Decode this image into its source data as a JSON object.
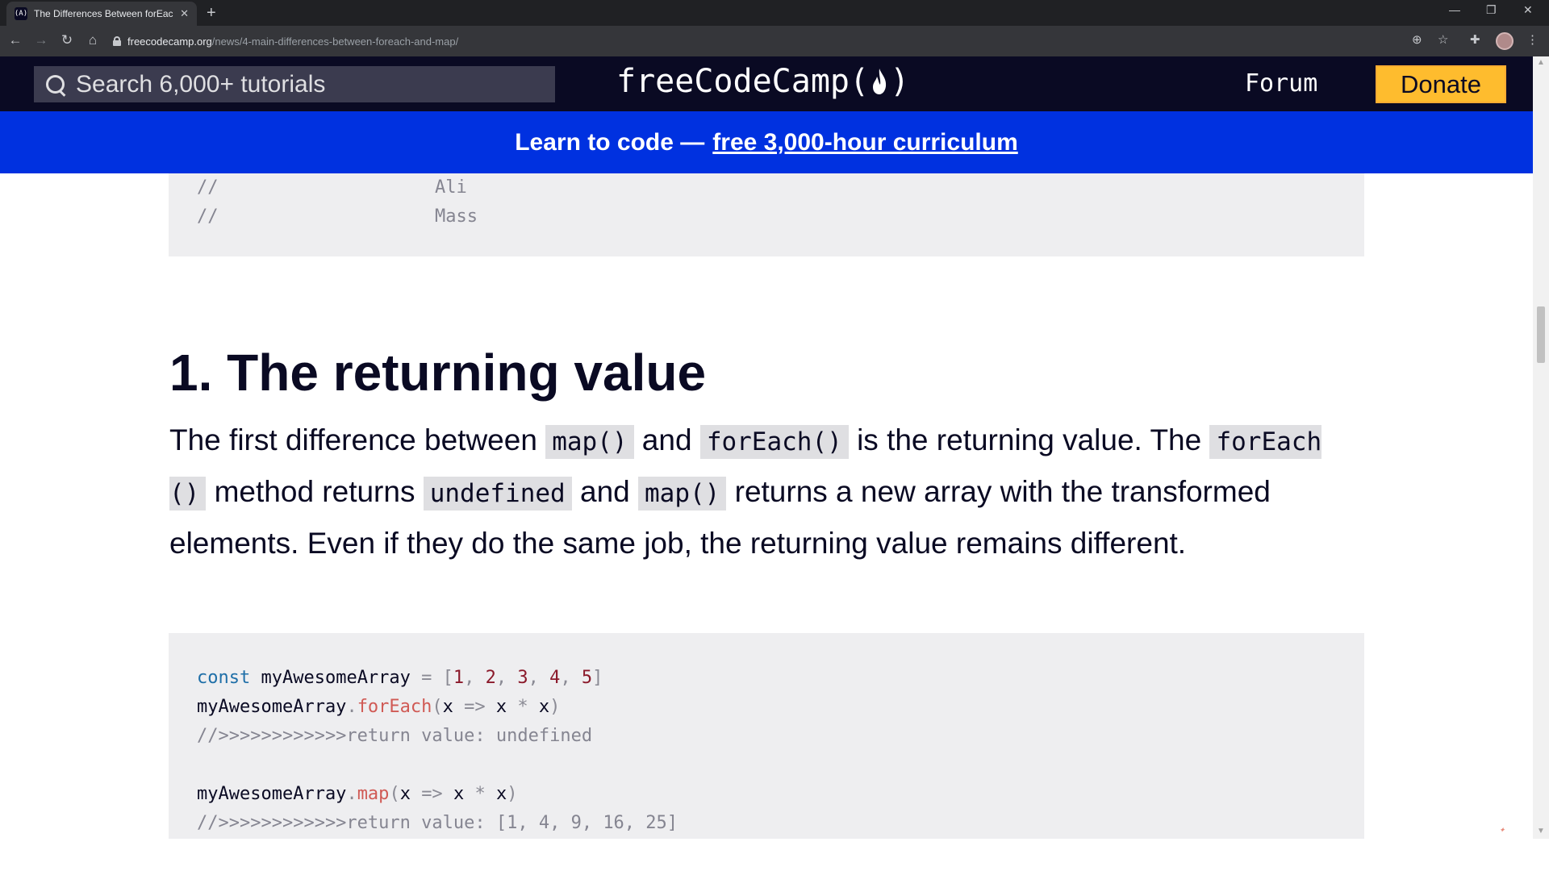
{
  "browser": {
    "tab_title": "The Differences Between forEach",
    "tab_favicon": "(A)",
    "new_tab_icon": "+",
    "url_host": "freecodecamp.org",
    "url_path": "/news/4-main-differences-between-foreach-and-map/",
    "icons": [
      "back-arrow-icon",
      "forward-arrow-icon",
      "reload-icon",
      "home-icon",
      "lock-icon",
      "zoom-icon",
      "star-icon",
      "extensions-icon",
      "profile-avatar",
      "kebab-menu-icon",
      "minimize-icon",
      "restore-icon",
      "close-icon"
    ]
  },
  "site": {
    "search_placeholder": "Search 6,000+ tutorials",
    "logo_text": "freeCodeCamp(",
    "logo_close": ")",
    "forum_label": "Forum",
    "donate_label": "Donate",
    "banner_text": "Learn to code —",
    "banner_link": "free 3,000-hour curriculum",
    "colors": {
      "nav_bg": "#0a0a23",
      "banner_bg": "#0031e0",
      "donate_bg": "#febc2e"
    }
  },
  "article": {
    "prev_code": [
      {
        "slashes": "//",
        "value": "Ali"
      },
      {
        "slashes": "//",
        "value": "Mass"
      }
    ],
    "heading": "1. The returning value",
    "paragraph": {
      "t1": "The first difference between ",
      "c1": "map()",
      "t2": " and ",
      "c2": "forEach()",
      "t3": " is the returning value. The ",
      "c3": "forEach ()",
      "t4": " method returns ",
      "c4": "undefined",
      "t5": " and ",
      "c5": "map()",
      "t6": " returns a new array with the transformed elements. Even if they do the same job, the returning value remains different."
    },
    "code": {
      "kw_const": "const",
      "array_name": "myAwesomeArray",
      "eq": "=",
      "open": "[",
      "close": "]",
      "comma": ",",
      "nums": [
        "1",
        "2",
        "3",
        "4",
        "5"
      ],
      "dot": ".",
      "foreach": "forEach",
      "map": "map",
      "lparen": "(",
      "rparen": ")",
      "x": "x",
      "arrow": "=>",
      "star": "*",
      "comment_foreach": "//>>>>>>>>>>>>return value: undefined",
      "comment_map": "//>>>>>>>>>>>>return value: [1, 4, 9, 16, 25]"
    }
  }
}
